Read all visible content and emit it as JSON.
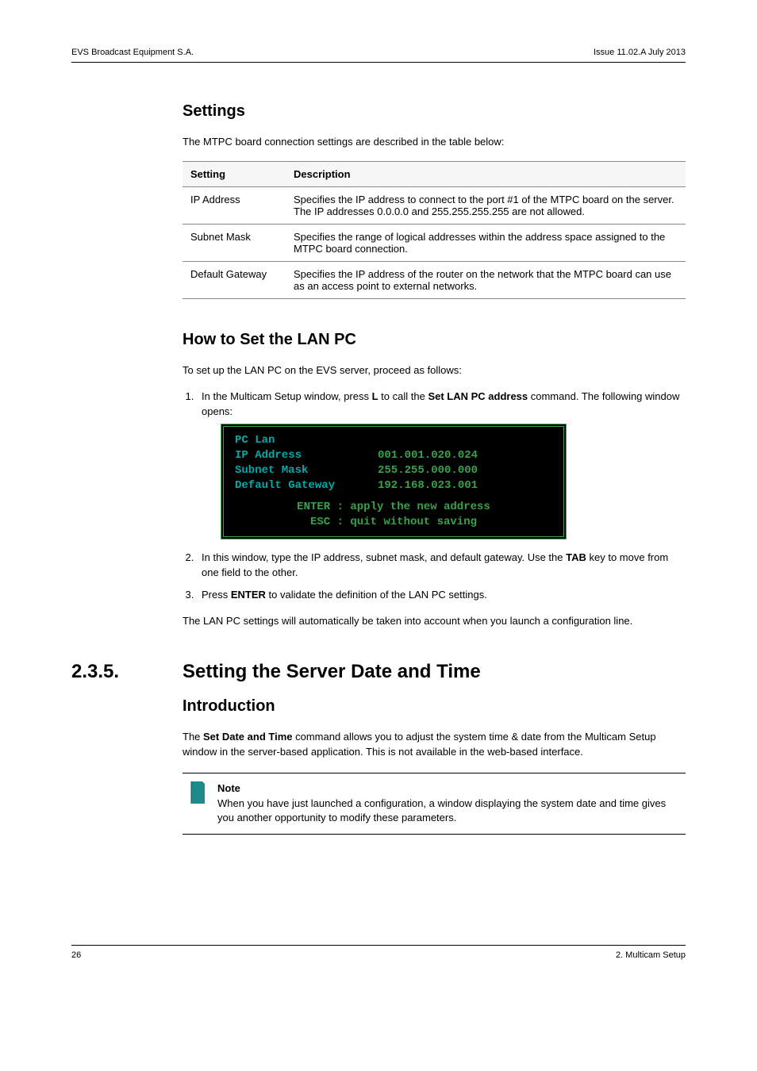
{
  "header": {
    "left": "EVS Broadcast Equipment S.A.",
    "right": "Issue 11.02.A  July 2013"
  },
  "settings": {
    "heading": "Settings",
    "intro": "The MTPC board connection settings are described in the table below:",
    "th1": "Setting",
    "th2": "Description",
    "rows": [
      {
        "c1": "IP Address",
        "c2": "Specifies the IP address to connect to the port #1 of the MTPC board on the server. The IP addresses 0.0.0.0 and 255.255.255.255 are not allowed."
      },
      {
        "c1": "Subnet Mask",
        "c2": "Specifies the range of logical addresses within the address space assigned to the MTPC board connection."
      },
      {
        "c1": "Default Gateway",
        "c2": "Specifies the IP address of the router on the network that the MTPC board can use as an access point to external networks."
      }
    ]
  },
  "lan": {
    "heading": "How to Set the LAN PC",
    "intro": "To set up the LAN PC on the EVS server, proceed as follows:",
    "step1_a": "In the Multicam Setup window, press ",
    "step1_key": "L",
    "step1_b": " to call the ",
    "step1_cmd": "Set LAN PC address",
    "step1_c": " command. The following window opens:",
    "term": {
      "l1": "PC Lan",
      "l2a": "IP Address",
      "l2b": "001.001.020.024",
      "l3a": "Subnet Mask",
      "l3b": "255.255.000.000",
      "l4a": "Default Gateway",
      "l4b": "192.168.023.001",
      "l5": "ENTER : apply the new address",
      "l6": "ESC   : quit without saving"
    },
    "step2_a": "In this window, type the IP address, subnet mask, and default gateway. Use the ",
    "step2_key": "TAB",
    "step2_b": " key to move from one field to the other.",
    "step3_a": "Press ",
    "step3_key": "ENTER",
    "step3_b": " to validate the definition of the LAN PC settings.",
    "outro": "The LAN PC settings will automatically be taken into account when you launch a configuration line."
  },
  "dt": {
    "num": "2.3.5.",
    "title": "Setting the Server Date and Time",
    "intro_h": "Introduction",
    "p_a": "The ",
    "p_cmd": "Set Date and Time",
    "p_b": " command allows you to adjust the system time & date from the Multicam Setup window in the server-based application. This is not available in the web-based interface.",
    "note_h": "Note",
    "note_t": "When you have just launched a configuration, a window displaying the system date and time gives you another opportunity to modify these parameters."
  },
  "footer": {
    "left": "26",
    "right": "2. Multicam Setup"
  }
}
